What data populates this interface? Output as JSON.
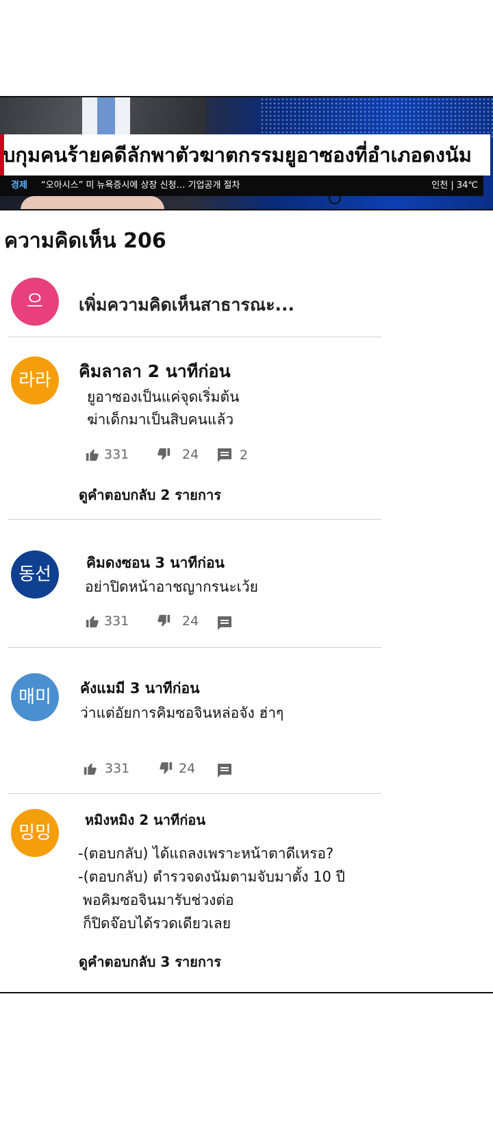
{
  "news": {
    "headline": "ับกุมคนร้ายคดีลักพาตัวฆาตกรรมยูอาซองที่อำเภอดงนัม",
    "ticker_category": "경제",
    "ticker_text": "“오아시스” 미 뉴욕증시에 상장 신청… 기업공개 절차",
    "ticker_weather": "인천 | 34℃"
  },
  "comments_header": {
    "title": "ความคิดเห็น 206"
  },
  "add_comment": {
    "avatar_text": "으",
    "placeholder": "เพิ่มความคิดเห็นสาธารณะ..."
  },
  "colors": {
    "pink": "#e8407a",
    "orange": "#f59e0b",
    "navy": "#0f3f8f",
    "sky": "#4a8fd0"
  },
  "comments": [
    {
      "avatar_text": "라라",
      "author": "คิมลาลา 2 นาทีก่อน",
      "lines": [
        "ยูอาซองเป็นแค่จุดเริ่มต้น",
        "ฆ่าเด็กมาเป็นสิบคนแล้ว"
      ],
      "likes": "331",
      "dislikes": "24",
      "replies": "2",
      "view_replies": "ดูคำตอบกลับ 2 รายการ"
    },
    {
      "avatar_text": "동선",
      "author": "คิมดงซอน 3 นาทีก่อน",
      "lines": [
        "อย่าปิดหน้าอาชญากรนะเว้ย"
      ],
      "likes": "331",
      "dislikes": "24"
    },
    {
      "avatar_text": "매미",
      "author": "คังแมมี 3 นาทีก่อน",
      "lines": [
        "ว่าแต่อัยการคิมซอจินหล่อจัง ฮ่าๆ"
      ],
      "likes": "331",
      "dislikes": "24"
    },
    {
      "avatar_text": "밍밍",
      "author": "หมิงหมิง 2 นาทีก่อน",
      "lines": [
        "-(ตอบกลับ) ได้แถลงเพราะหน้าตาดีเหรอ?",
        "-(ตอบกลับ) ตำรวจดงนัมตามจับมาตั้ง 10 ปี",
        "พอคิมซอจินมารับช่วงต่อ",
        "ก็ปิดจ๊อบได้รวดเดียวเลย"
      ],
      "view_replies": "ดูคำตอบกลับ 3 รายการ"
    }
  ]
}
